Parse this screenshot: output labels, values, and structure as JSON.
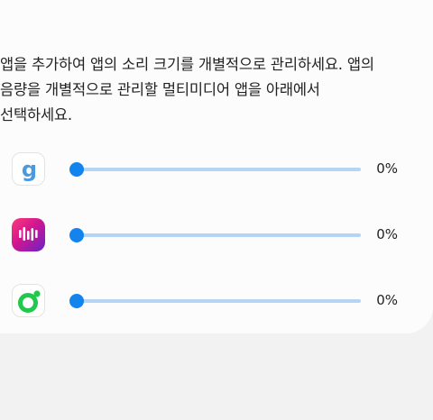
{
  "description": "앱을 추가하여 앱의 소리 크기를 개별적으로 관리하세요. 앱의\n음량을 개별적으로 관리할 멀티미디어 앱을 아래에서\n선택하세요.",
  "apps": [
    {
      "icon": "g-letter-app-icon",
      "volume": 0,
      "volume_label": "0%"
    },
    {
      "icon": "audio-waveform-app-icon",
      "volume": 0,
      "volume_label": "0%"
    },
    {
      "icon": "green-circle-app-icon",
      "volume": 0,
      "volume_label": "0%"
    }
  ],
  "colors": {
    "slider_active": "#1384ee",
    "slider_track": "#b5d5f5",
    "icon_g_blue": "#4a9ae2",
    "icon_wave_magenta": "#d0168f",
    "icon_circle_green": "#1ec94b"
  }
}
